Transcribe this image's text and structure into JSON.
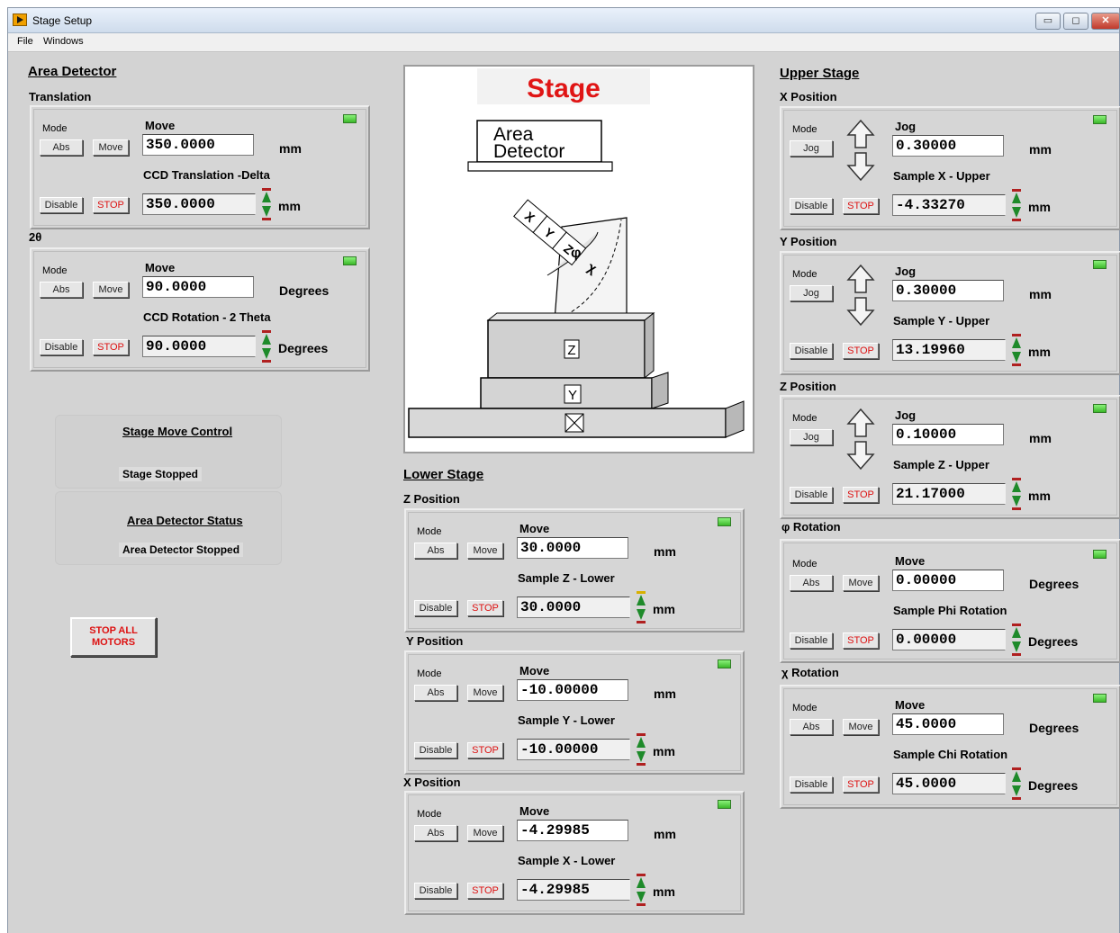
{
  "window": {
    "title": "Stage Setup",
    "btn_min": "▭",
    "btn_max": "◻",
    "btn_close": "✕"
  },
  "menu": {
    "file": "File",
    "windows": "Windows"
  },
  "common": {
    "mode": "Mode",
    "abs": "Abs",
    "move_btn": "Move",
    "jog_btn": "Jog",
    "disable": "Disable",
    "stop": "STOP",
    "move": "Move",
    "jog": "Jog"
  },
  "area_detector": {
    "title": "Area Detector",
    "translation": {
      "label": "Translation",
      "move_value": "350.0000",
      "unit": "mm",
      "readout_label": "CCD Translation -Delta",
      "readout_value": "350.0000",
      "readout_unit": "mm"
    },
    "two_theta": {
      "label": "2θ",
      "move_value": "90.0000",
      "unit": "Degrees",
      "readout_label": "CCD Rotation - 2 Theta",
      "readout_value": "90.0000",
      "readout_unit": "Degrees"
    }
  },
  "stage_move": {
    "title": "Stage Move Control",
    "status": "Stage Stopped"
  },
  "detector_status": {
    "title": "Area Detector Status",
    "status": "Area Detector Stopped"
  },
  "stop_all": {
    "line1": "STOP ALL",
    "line2": "MOTORS"
  },
  "diagram": {
    "title": "Stage",
    "detector_line1": "Area",
    "detector_line2": "Detector",
    "labels": {
      "x": "X",
      "y": "Y",
      "z": "Z",
      "phi": "φ",
      "chi": "χ"
    }
  },
  "lower_stage": {
    "title": "Lower Stage",
    "z": {
      "label": "Z Position",
      "move_value": "30.0000",
      "unit": "mm",
      "readout_label": "Sample Z - Lower",
      "readout_value": "30.0000",
      "readout_unit": "mm"
    },
    "y": {
      "label": "Y Position",
      "move_value": "-10.00000",
      "unit": "mm",
      "readout_label": "Sample Y - Lower",
      "readout_value": "-10.00000",
      "readout_unit": "mm"
    },
    "x": {
      "label": "X Position",
      "move_value": "-4.29985",
      "unit": "mm",
      "readout_label": "Sample X - Lower",
      "readout_value": "-4.29985",
      "readout_unit": "mm"
    }
  },
  "upper_stage": {
    "title": "Upper Stage",
    "x": {
      "label": "X Position",
      "jog_value": "0.30000",
      "unit": "mm",
      "readout_label": "Sample X - Upper",
      "readout_value": "-4.33270",
      "readout_unit": "mm"
    },
    "y": {
      "label": "Y Position",
      "jog_value": "0.30000",
      "unit": "mm",
      "readout_label": "Sample Y - Upper",
      "readout_value": "13.19960",
      "readout_unit": "mm"
    },
    "z": {
      "label": "Z Position",
      "jog_value": "0.10000",
      "unit": "mm",
      "readout_label": "Sample Z - Upper",
      "readout_value": "21.17000",
      "readout_unit": "mm"
    },
    "phi": {
      "label": "φ Rotation",
      "move_value": "0.00000",
      "unit": "Degrees",
      "readout_label": "Sample Phi Rotation",
      "readout_value": "0.00000",
      "readout_unit": "Degrees"
    },
    "chi": {
      "label": "χ Rotation",
      "move_value": "45.0000",
      "unit": "Degrees",
      "readout_label": "Sample Chi Rotation",
      "readout_value": "45.0000",
      "readout_unit": "Degrees"
    }
  }
}
